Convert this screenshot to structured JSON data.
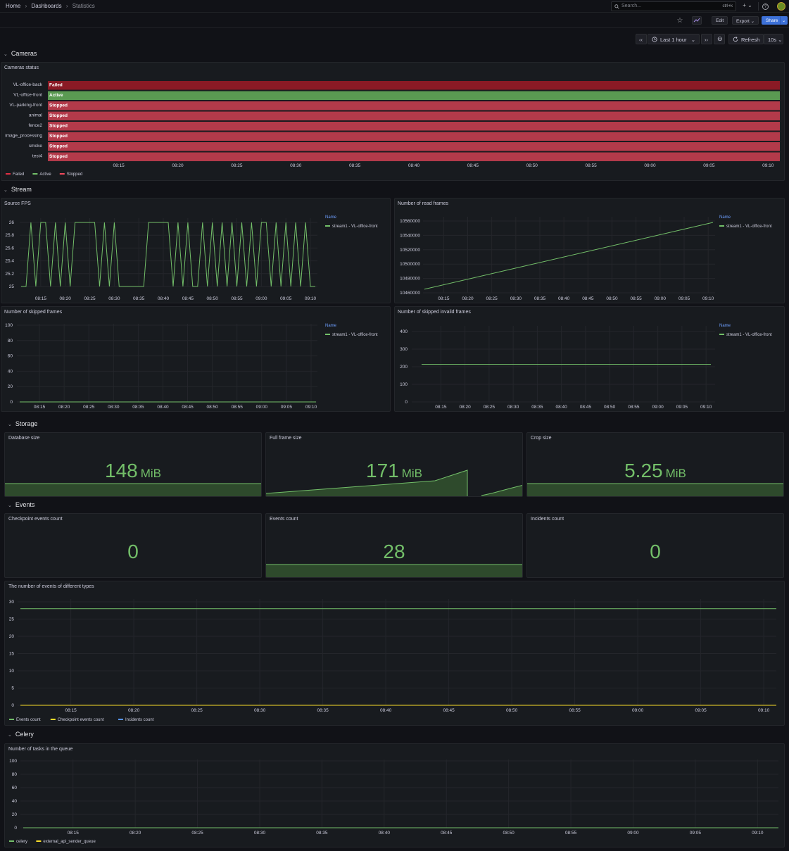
{
  "breadcrumb": {
    "home": "Home",
    "dashboards": "Dashboards",
    "current": "Statistics",
    "sep": "›"
  },
  "search": {
    "placeholder": "Search...",
    "shortcut": "ctrl+k"
  },
  "topbar": {
    "plus": "+ ⌄",
    "help": "?",
    "star": "☆"
  },
  "toolbar": {
    "edit": "Edit",
    "export": "Export ⌄",
    "share": "Share",
    "share_caret": "⌄"
  },
  "time": {
    "prev": "‹‹",
    "range": "Last 1 hour",
    "caret": "⌄",
    "next": "››",
    "zoom": "⊖",
    "refresh": "Refresh",
    "interval": "10s ⌄"
  },
  "colors": {
    "green": "#73bf69",
    "darkred": "#8a1a25",
    "red": "#b33a4a",
    "activegreen": "#5a9a52",
    "yellow": "#fade2a",
    "blue": "#5794f2"
  },
  "sections": {
    "cameras": "Cameras",
    "stream": "Stream",
    "storage": "Storage",
    "events": "Events",
    "celery": "Celery"
  },
  "cameras_panel": {
    "title": "Cameras status",
    "rows": [
      {
        "name": "VL-office-back",
        "status": "Failed"
      },
      {
        "name": "VL-office-front",
        "status": "Active"
      },
      {
        "name": "VL-parking-front",
        "status": "Stopped"
      },
      {
        "name": "animal",
        "status": "Stopped"
      },
      {
        "name": "fence2",
        "status": "Stopped"
      },
      {
        "name": "image_processing",
        "status": "Stopped"
      },
      {
        "name": "smoke",
        "status": "Stopped"
      },
      {
        "name": "test4",
        "status": "Stopped"
      }
    ],
    "legend": [
      "Failed",
      "Active",
      "Stopped"
    ]
  },
  "time_ticks": [
    "08:15",
    "08:20",
    "08:25",
    "08:30",
    "08:35",
    "08:40",
    "08:45",
    "08:50",
    "08:55",
    "09:00",
    "09:05",
    "09:10"
  ],
  "stream": {
    "legend_header": "Name",
    "series_name": "stream1 - VL-office-front",
    "source_fps": {
      "title": "Source FPS",
      "yticks": [
        "26",
        "25.8",
        "25.6",
        "25.4",
        "25.2",
        "25"
      ]
    },
    "read_frames": {
      "title": "Number of read frames",
      "yticks": [
        "10560000",
        "10540000",
        "10520000",
        "10500000",
        "10480000",
        "10460000"
      ]
    },
    "skipped": {
      "title": "Number of skipped frames",
      "yticks": [
        "100",
        "80",
        "60",
        "40",
        "20",
        "0"
      ]
    },
    "skipped_invalid": {
      "title": "Number of skipped invalid frames",
      "yticks": [
        "400",
        "300",
        "200",
        "100",
        "0"
      ]
    }
  },
  "storage": [
    {
      "title": "Database size",
      "value": "148",
      "unit": "MiB"
    },
    {
      "title": "Full frame size",
      "value": "171",
      "unit": "MiB"
    },
    {
      "title": "Crop size",
      "value": "5.25",
      "unit": "MiB"
    }
  ],
  "events": [
    {
      "title": "Checkpoint events count",
      "value": "0"
    },
    {
      "title": "Events count",
      "value": "28"
    },
    {
      "title": "Incidents count",
      "value": "0"
    }
  ],
  "chart_data": [
    {
      "type": "line",
      "title": "Source FPS",
      "x": [
        "08:11",
        "08:12",
        "08:13",
        "08:14",
        "08:15",
        "08:16",
        "08:17",
        "08:18",
        "08:19",
        "08:20",
        "08:21",
        "08:22",
        "08:23",
        "08:24",
        "08:25",
        "08:26",
        "08:27",
        "08:28",
        "08:29",
        "08:30",
        "08:31",
        "08:32",
        "08:33",
        "08:34",
        "08:35",
        "08:36",
        "08:37",
        "08:38",
        "08:39",
        "08:40",
        "08:41",
        "08:42",
        "08:43",
        "08:44",
        "08:45",
        "08:46",
        "08:47",
        "08:48",
        "08:49",
        "08:50",
        "08:51",
        "08:52",
        "08:53",
        "08:54",
        "08:55",
        "08:56",
        "08:57",
        "08:58",
        "08:59",
        "09:00",
        "09:01",
        "09:02",
        "09:03",
        "09:04",
        "09:05",
        "09:06",
        "09:07",
        "09:08",
        "09:09",
        "09:10",
        "09:11"
      ],
      "series": [
        {
          "name": "stream1 - VL-office-front",
          "values": [
            25,
            25,
            26,
            25,
            26,
            26,
            25,
            26,
            25,
            26,
            25,
            26,
            26,
            26,
            26,
            26,
            25,
            26,
            25,
            26,
            25,
            25,
            25,
            25,
            25,
            25,
            26,
            26,
            26,
            26,
            26,
            25,
            26,
            25,
            26,
            25,
            25,
            26,
            25,
            26,
            25,
            26,
            25,
            26,
            25,
            26,
            25,
            26,
            25,
            26,
            26,
            25,
            26,
            25,
            26,
            25,
            26,
            25,
            26,
            25,
            25
          ]
        }
      ],
      "ylim": [
        25,
        26
      ]
    },
    {
      "type": "line",
      "title": "Number of read frames",
      "x": [
        "08:11",
        "09:11"
      ],
      "series": [
        {
          "name": "stream1 - VL-office-front",
          "values": [
            10465000,
            10558000
          ]
        }
      ],
      "ylim": [
        10460000,
        10560000
      ]
    },
    {
      "type": "line",
      "title": "Number of skipped frames",
      "x": [
        "08:11",
        "09:11"
      ],
      "series": [
        {
          "name": "stream1 - VL-office-front",
          "values": [
            0,
            0
          ]
        }
      ],
      "ylim": [
        0,
        100
      ]
    },
    {
      "type": "line",
      "title": "Number of skipped invalid frames",
      "x": [
        "08:11",
        "09:11"
      ],
      "series": [
        {
          "name": "stream1 - VL-office-front",
          "values": [
            214,
            214
          ]
        }
      ],
      "ylim": [
        0,
        400
      ]
    },
    {
      "type": "line",
      "title": "The number of events of different types",
      "x": [
        "08:11",
        "09:11"
      ],
      "series": [
        {
          "name": "Events count",
          "values": [
            28,
            28
          ]
        },
        {
          "name": "Checkpoint events count",
          "values": [
            0,
            0
          ]
        },
        {
          "name": "Incidents count",
          "values": [
            0,
            0
          ]
        }
      ],
      "yticks": [
        "30",
        "25",
        "20",
        "15",
        "10",
        "5",
        "0"
      ],
      "ylim": [
        0,
        30
      ]
    },
    {
      "type": "line",
      "title": "Number of tasks in the queue",
      "x": [
        "08:11",
        "09:11"
      ],
      "series": [
        {
          "name": "celery",
          "values": [
            0,
            0
          ]
        },
        {
          "name": "external_api_sender_queue",
          "values": [
            0,
            0
          ]
        }
      ],
      "yticks": [
        "100",
        "80",
        "60",
        "40",
        "20",
        "0"
      ],
      "ylim": [
        0,
        100
      ]
    }
  ]
}
